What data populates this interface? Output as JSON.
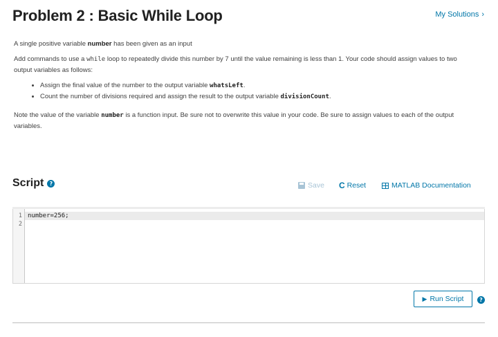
{
  "header": {
    "title": "Problem 2 : Basic While Loop",
    "my_solutions": "My Solutions",
    "chevron": "›"
  },
  "description": {
    "p1_pre": "A single positive variable ",
    "p1_var": "number",
    "p1_post": " has been given as an input",
    "p2_pre": "Add commands to use a ",
    "p2_code": "while",
    "p2_post": " loop to repeatedly divide this number by 7 until the value remaining is less than 1. Your code should assign values to two output variables as follows:",
    "bullet1_pre": "Assign the final value of the number to the output variable ",
    "bullet1_var": "whatsLeft",
    "bullet1_post": ".",
    "bullet2_pre": "Count the number of divisions required and assign the result to the output variable ",
    "bullet2_var": "divisionCount",
    "bullet2_post": ".",
    "p3_pre": "Note the value of the variable ",
    "p3_var": "number",
    "p3_post": " is a function input. Be sure not to overwrite this value in your code. Be sure to assign values to each of the output variables."
  },
  "script": {
    "heading": "Script",
    "help_icon": "?",
    "save_label": "Save",
    "reset_label": "Reset",
    "reset_icon": "C",
    "doc_label": "MATLAB Documentation"
  },
  "editor": {
    "line_numbers": [
      "1",
      "2"
    ],
    "lines": [
      "number=256;",
      ""
    ]
  },
  "footer": {
    "run_label": "Run Script",
    "play_icon": "▶",
    "help_icon": "?"
  },
  "colors": {
    "accent": "#0076a8",
    "disabled": "#a8c4d6"
  }
}
